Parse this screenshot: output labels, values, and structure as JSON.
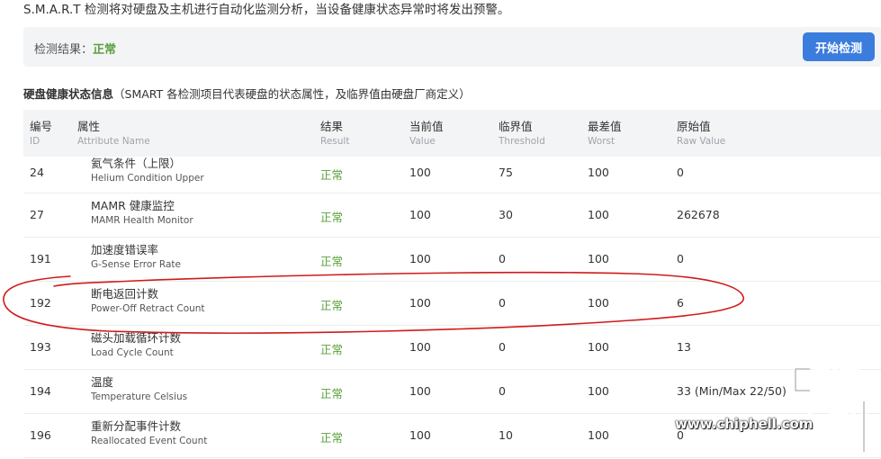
{
  "intro_text": "S.M.A.R.T 检测将对硬盘及主机进行自动化监测分析，当设备健康状态异常时将发出预警。",
  "result": {
    "label": "检测结果：",
    "value": "正常",
    "button_label": "开始检测"
  },
  "section": {
    "title": "硬盘健康状态信息",
    "note": "（SMART 各检测项目代表硬盘的状态属性，及临界值由硬盘厂商定义）"
  },
  "table": {
    "columns": [
      {
        "zh": "编号",
        "en": "ID"
      },
      {
        "zh": "属性",
        "en": "Attribute Name"
      },
      {
        "zh": "结果",
        "en": "Result"
      },
      {
        "zh": "当前值",
        "en": "Value"
      },
      {
        "zh": "临界值",
        "en": "Threshold"
      },
      {
        "zh": "最差值",
        "en": "Worst"
      },
      {
        "zh": "原始值",
        "en": "Raw Value"
      }
    ],
    "rows": [
      {
        "id": "24",
        "zh": "氦气条件（上限）",
        "en": "Helium Condition Upper",
        "result": "正常",
        "value": "100",
        "threshold": "75",
        "worst": "100",
        "raw": "0"
      },
      {
        "id": "27",
        "zh": "MAMR 健康监控",
        "en": "MAMR Health Monitor",
        "result": "正常",
        "value": "100",
        "threshold": "30",
        "worst": "100",
        "raw": "262678"
      },
      {
        "id": "191",
        "zh": "加速度错误率",
        "en": "G-Sense Error Rate",
        "result": "正常",
        "value": "100",
        "threshold": "0",
        "worst": "100",
        "raw": "0"
      },
      {
        "id": "192",
        "zh": "断电返回计数",
        "en": "Power-Off Retract Count",
        "result": "正常",
        "value": "100",
        "threshold": "0",
        "worst": "100",
        "raw": "6"
      },
      {
        "id": "193",
        "zh": "磁头加载循环计数",
        "en": "Load Cycle Count",
        "result": "正常",
        "value": "100",
        "threshold": "0",
        "worst": "100",
        "raw": "13"
      },
      {
        "id": "194",
        "zh": "温度",
        "en": "Temperature Celsius",
        "result": "正常",
        "value": "100",
        "threshold": "0",
        "worst": "100",
        "raw": "33 (Min/Max 22/50)"
      },
      {
        "id": "196",
        "zh": "重新分配事件计数",
        "en": "Reallocated Event Count",
        "result": "正常",
        "value": "100",
        "threshold": "10",
        "worst": "100",
        "raw": "0"
      }
    ]
  },
  "watermark": {
    "logo_text": "chip hell",
    "url": "www.chiphell.com"
  },
  "colors": {
    "ok_green": "#5aa03c",
    "button_blue": "#3b7ddd",
    "header_bg": "#f3f4f6",
    "annotation_red": "#d11a1a"
  }
}
